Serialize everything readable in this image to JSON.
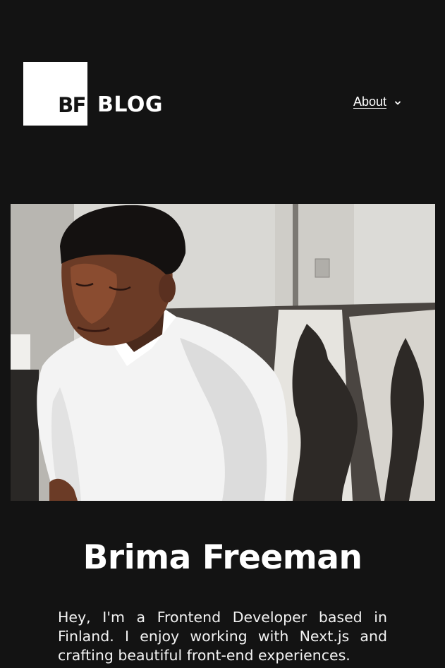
{
  "header": {
    "logo_monogram": "BF",
    "logo_text": "BLOG",
    "nav": [
      {
        "label": "About",
        "has_dropdown": true,
        "icon": "chevron-down-icon"
      }
    ]
  },
  "hero": {
    "image_description_icon": "portrait-photo"
  },
  "profile": {
    "name": "Brima Freeman",
    "bio": "Hey, I'm a Frontend Developer based in Finland. I enjoy working with Next.js and crafting beautiful front-end experiences."
  },
  "colors": {
    "background": "#131313",
    "text": "#ffffff",
    "logo_box": "#ffffff"
  }
}
